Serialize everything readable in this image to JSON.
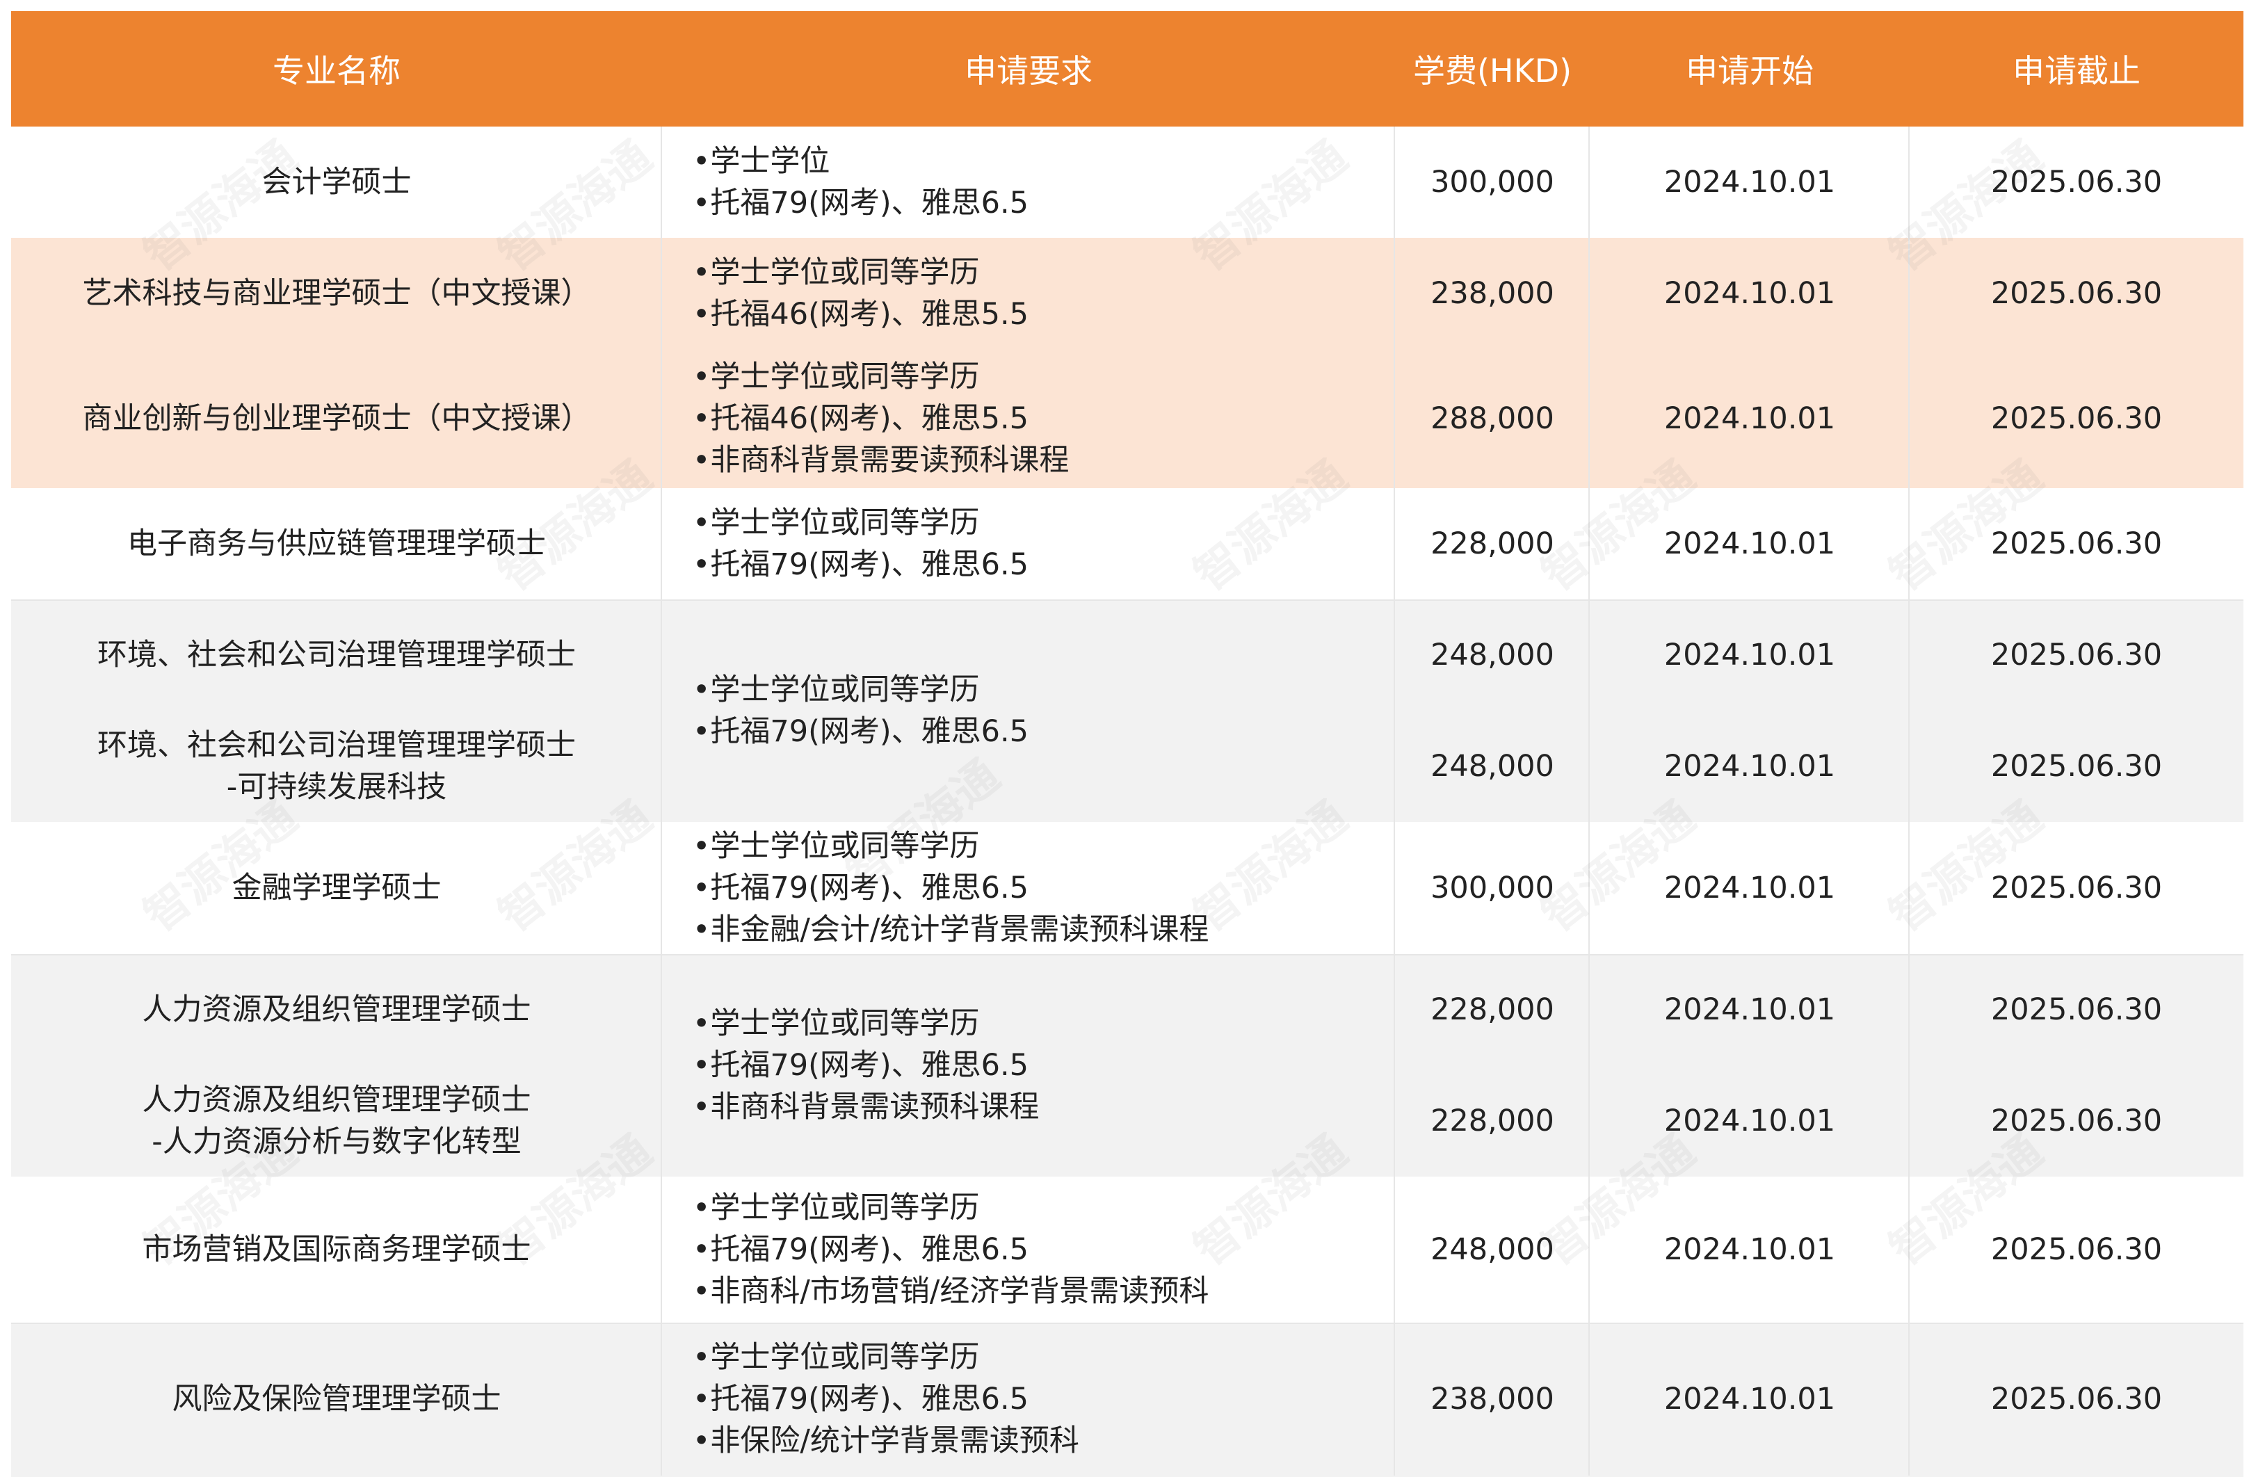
{
  "headers": {
    "name": "专业名称",
    "requirements": "申请要求",
    "fee": "学费(HKD)",
    "open": "申请开始",
    "close": "申请截止"
  },
  "watermark": "智源海通",
  "colors": {
    "header_bg": "#ED832F",
    "peach_band": "#FCE4D4",
    "grey_band": "#F2F2F2"
  },
  "rows": [
    {
      "name": "会计学硕士",
      "req": [
        "•学士学位",
        "•托福79(网考)、雅思6.5"
      ],
      "fee": "300,000",
      "open": "2024.10.01",
      "close": "2025.06.30"
    },
    {
      "name": "艺术科技与商业理学硕士（中文授课）",
      "req": [
        "•学士学位或同等学历",
        "•托福46(网考)、雅思5.5"
      ],
      "fee": "238,000",
      "open": "2024.10.01",
      "close": "2025.06.30"
    },
    {
      "name": "商业创新与创业理学硕士（中文授课）",
      "req": [
        "•学士学位或同等学历",
        "•托福46(网考)、雅思5.5",
        "•非商科背景需要读预科课程"
      ],
      "fee": "288,000",
      "open": "2024.10.01",
      "close": "2025.06.30"
    },
    {
      "name": "电子商务与供应链管理理学硕士",
      "req": [
        "•学士学位或同等学历",
        "•托福79(网考)、雅思6.5"
      ],
      "fee": "228,000",
      "open": "2024.10.01",
      "close": "2025.06.30"
    },
    {
      "name": "环境、社会和公司治理管理理学硕士",
      "fee": "248,000",
      "open": "2024.10.01",
      "close": "2025.06.30"
    },
    {
      "name": "环境、社会和公司治理管理理学硕士",
      "name2": "-可持续发展科技",
      "fee": "248,000",
      "open": "2024.10.01",
      "close": "2025.06.30"
    },
    {
      "name": "金融学理学硕士",
      "req": [
        "•学士学位或同等学历",
        "•托福79(网考)、雅思6.5",
        "•非金融/会计/统计学背景需读预科课程"
      ],
      "fee": "300,000",
      "open": "2024.10.01",
      "close": "2025.06.30"
    },
    {
      "name": "人力资源及组织管理理学硕士",
      "fee": "228,000",
      "open": "2024.10.01",
      "close": "2025.06.30"
    },
    {
      "name": "人力资源及组织管理理学硕士",
      "name2": "-人力资源分析与数字化转型",
      "fee": "228,000",
      "open": "2024.10.01",
      "close": "2025.06.30"
    },
    {
      "name": "市场营销及国际商务理学硕士",
      "req": [
        "•学士学位或同等学历",
        "•托福79(网考)、雅思6.5",
        "•非商科/市场营销/经济学背景需读预科"
      ],
      "fee": "248,000",
      "open": "2024.10.01",
      "close": "2025.06.30"
    },
    {
      "name": "风险及保险管理理学硕士",
      "req": [
        "•学士学位或同等学历",
        "•托福79(网考)、雅思6.5",
        "•非保险/统计学背景需读预科"
      ],
      "fee": "238,000",
      "open": "2024.10.01",
      "close": "2025.06.30"
    }
  ],
  "merged_requirements": {
    "esg": [
      "•学士学位或同等学历",
      "•托福79(网考)、雅思6.5"
    ],
    "hr": [
      "•学士学位或同等学历",
      "•托福79(网考)、雅思6.5",
      "•非商科背景需读预科课程"
    ]
  }
}
